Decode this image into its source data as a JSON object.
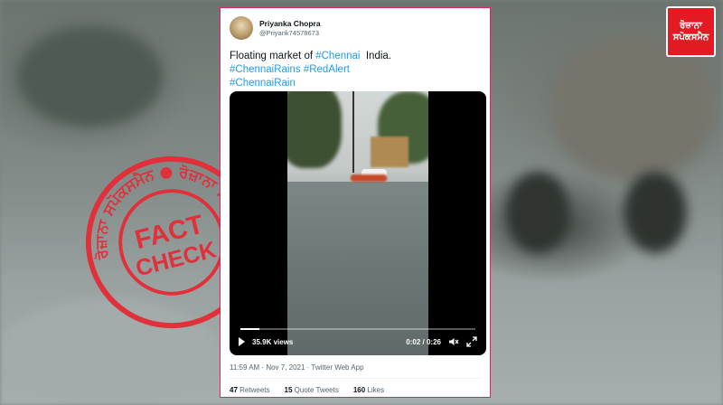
{
  "tweet": {
    "display_name": "Priyanka Chopra",
    "handle": "@Priyank74578673",
    "text_prefix": "Floating market of ",
    "hashtag_chennai": "#Chennai",
    "text_suffix": "  India.",
    "hashtags_line2": "#ChennaiRains #RedAlert",
    "hashtags_line3": "#ChennaiRain",
    "meta": "11:59 AM · Nov 7, 2021 · Twitter Web App",
    "stats": {
      "retweets_count": "47",
      "retweets_label": "Retweets",
      "quotes_count": "15",
      "quotes_label": "Quote Tweets",
      "likes_count": "160",
      "likes_label": "Likes"
    }
  },
  "video": {
    "views": "35.9K views",
    "time": "0:02 / 0:26",
    "progress_fraction": 0.08
  },
  "logo": {
    "line1": "ਰੋਜ਼ਾਨਾ",
    "line2": "ਸਪੋਕਸਮੈਨ"
  },
  "stamp": {
    "center_line1": "FACT",
    "center_line2": "CHECK",
    "ring_text": "ਰੋਜ਼ਾਨਾ ਸਪੋਕਸਮੈਨ ● ਰੋਜ਼ਾਨਾ ਸਪੋਕਸਮੈਨ ●",
    "color": "#e0303a"
  },
  "icons": {
    "play": "play-icon",
    "volume": "volume-icon",
    "expand": "expand-icon"
  }
}
